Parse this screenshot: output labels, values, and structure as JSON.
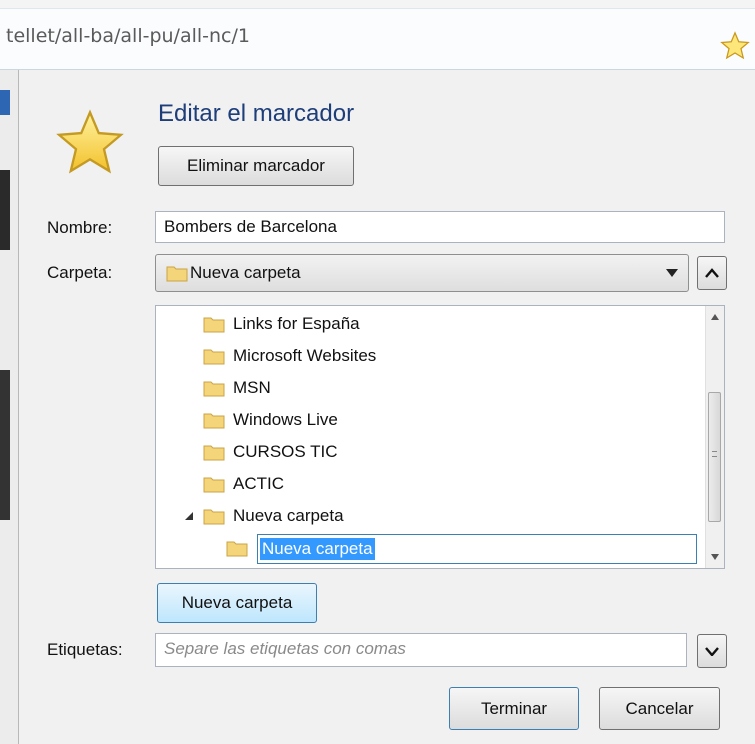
{
  "urlbar": {
    "url_text": "tellet/all-ba/all-pu/all-nc/1",
    "star_icon": "bookmark-star-icon"
  },
  "dialog": {
    "title": "Editar el marcador",
    "remove_button": "Eliminar marcador",
    "name_label": "Nombre:",
    "name_value": "Bombers de Barcelona",
    "folder_label": "Carpeta:",
    "folder_value": "Nueva carpeta",
    "tags_label": "Etiquetas:",
    "tags_placeholder": "Separe las etiquetas con comas",
    "new_folder_button": "Nueva carpeta",
    "done_button": "Terminar",
    "cancel_button": "Cancelar"
  },
  "tree": {
    "items": [
      {
        "label": "Links for España"
      },
      {
        "label": "Microsoft Websites"
      },
      {
        "label": "MSN"
      },
      {
        "label": "Windows Live"
      },
      {
        "label": "CURSOS TIC"
      },
      {
        "label": "ACTIC"
      },
      {
        "label": "Nueva carpeta"
      }
    ],
    "editing_value": "Nueva carpeta"
  },
  "colors": {
    "title": "#1e3e7a",
    "selection": "#3399ff",
    "star": "#f7c531"
  }
}
